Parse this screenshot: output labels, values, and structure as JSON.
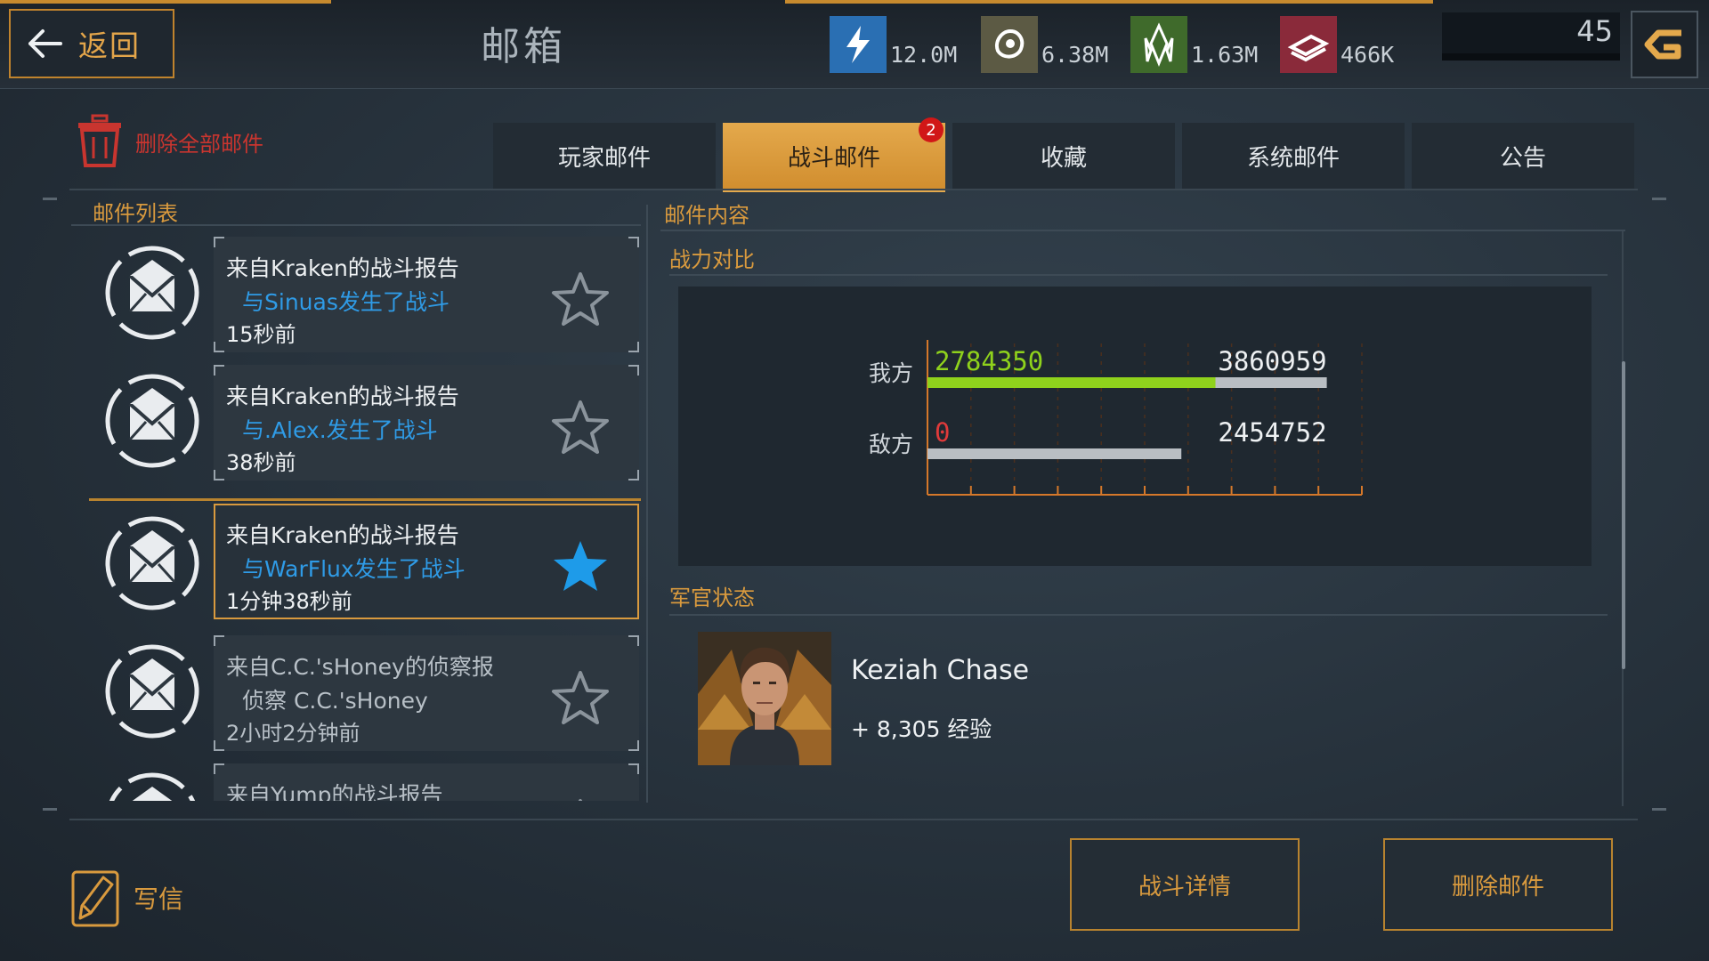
{
  "header": {
    "back_label": "返回",
    "title": "邮箱",
    "resources": [
      {
        "icon": "energy-icon",
        "value": "12.0M"
      },
      {
        "icon": "ore-icon",
        "value": "6.38M"
      },
      {
        "icon": "crystal-icon",
        "value": "1.63M"
      },
      {
        "icon": "alloy-icon",
        "value": "466K"
      }
    ],
    "level": "45"
  },
  "toolbar": {
    "delete_all_label": "删除全部邮件"
  },
  "tabs": [
    {
      "label": "玩家邮件"
    },
    {
      "label": "战斗邮件",
      "active": true,
      "badge": "2"
    },
    {
      "label": "收藏"
    },
    {
      "label": "系统邮件"
    },
    {
      "label": "公告"
    }
  ],
  "mail_list": {
    "title": "邮件列表",
    "items": [
      {
        "subject": "来自Kraken的战斗报告",
        "detail": "与Sinuas发生了战斗",
        "time": "15秒前",
        "starred": false
      },
      {
        "subject": "来自Kraken的战斗报告",
        "detail": "与.Alex.发生了战斗",
        "time": "38秒前",
        "starred": false
      },
      {
        "subject": "来自Kraken的战斗报告",
        "detail": "与WarFlux发生了战斗",
        "time": "1分钟38秒前",
        "starred": true,
        "selected": true
      },
      {
        "subject": "来自C.C.'sHoney的侦察报",
        "detail": "侦察 C.C.'sHoney",
        "time": "2小时2分钟前",
        "starred": false
      },
      {
        "subject": "来自Yump的战斗报告",
        "detail": "",
        "time": "",
        "starred": false
      }
    ]
  },
  "content": {
    "title": "邮件内容",
    "power_title": "战力对比",
    "officer_title": "军官状态",
    "officer": {
      "name": "Keziah Chase",
      "xp_value": "+ 8,305",
      "xp_unit": "经验"
    }
  },
  "chart_data": {
    "type": "bar",
    "orientation": "horizontal",
    "categories": [
      "我方",
      "敌方"
    ],
    "series": [
      {
        "values": [
          2784350,
          0
        ]
      },
      {
        "values": [
          3860959,
          2454752
        ]
      }
    ],
    "data_labels": [
      {
        "category": "我方",
        "current": "2784350",
        "total": "3860959"
      },
      {
        "category": "敌方",
        "current": "0",
        "total": "2454752"
      }
    ],
    "xlim": [
      0,
      4200000
    ],
    "grid": true,
    "colors": {
      "current": "#8fd21c",
      "total": "#b9bec3",
      "axis": "#d5782a"
    }
  },
  "footer": {
    "write_label": "写信",
    "battle_detail_label": "战斗详情",
    "delete_mail_label": "删除邮件"
  },
  "colors": {
    "accent": "#d99a3e",
    "active_tab": "#e4a94c",
    "link": "#2f9be6",
    "danger": "#c9352f"
  }
}
